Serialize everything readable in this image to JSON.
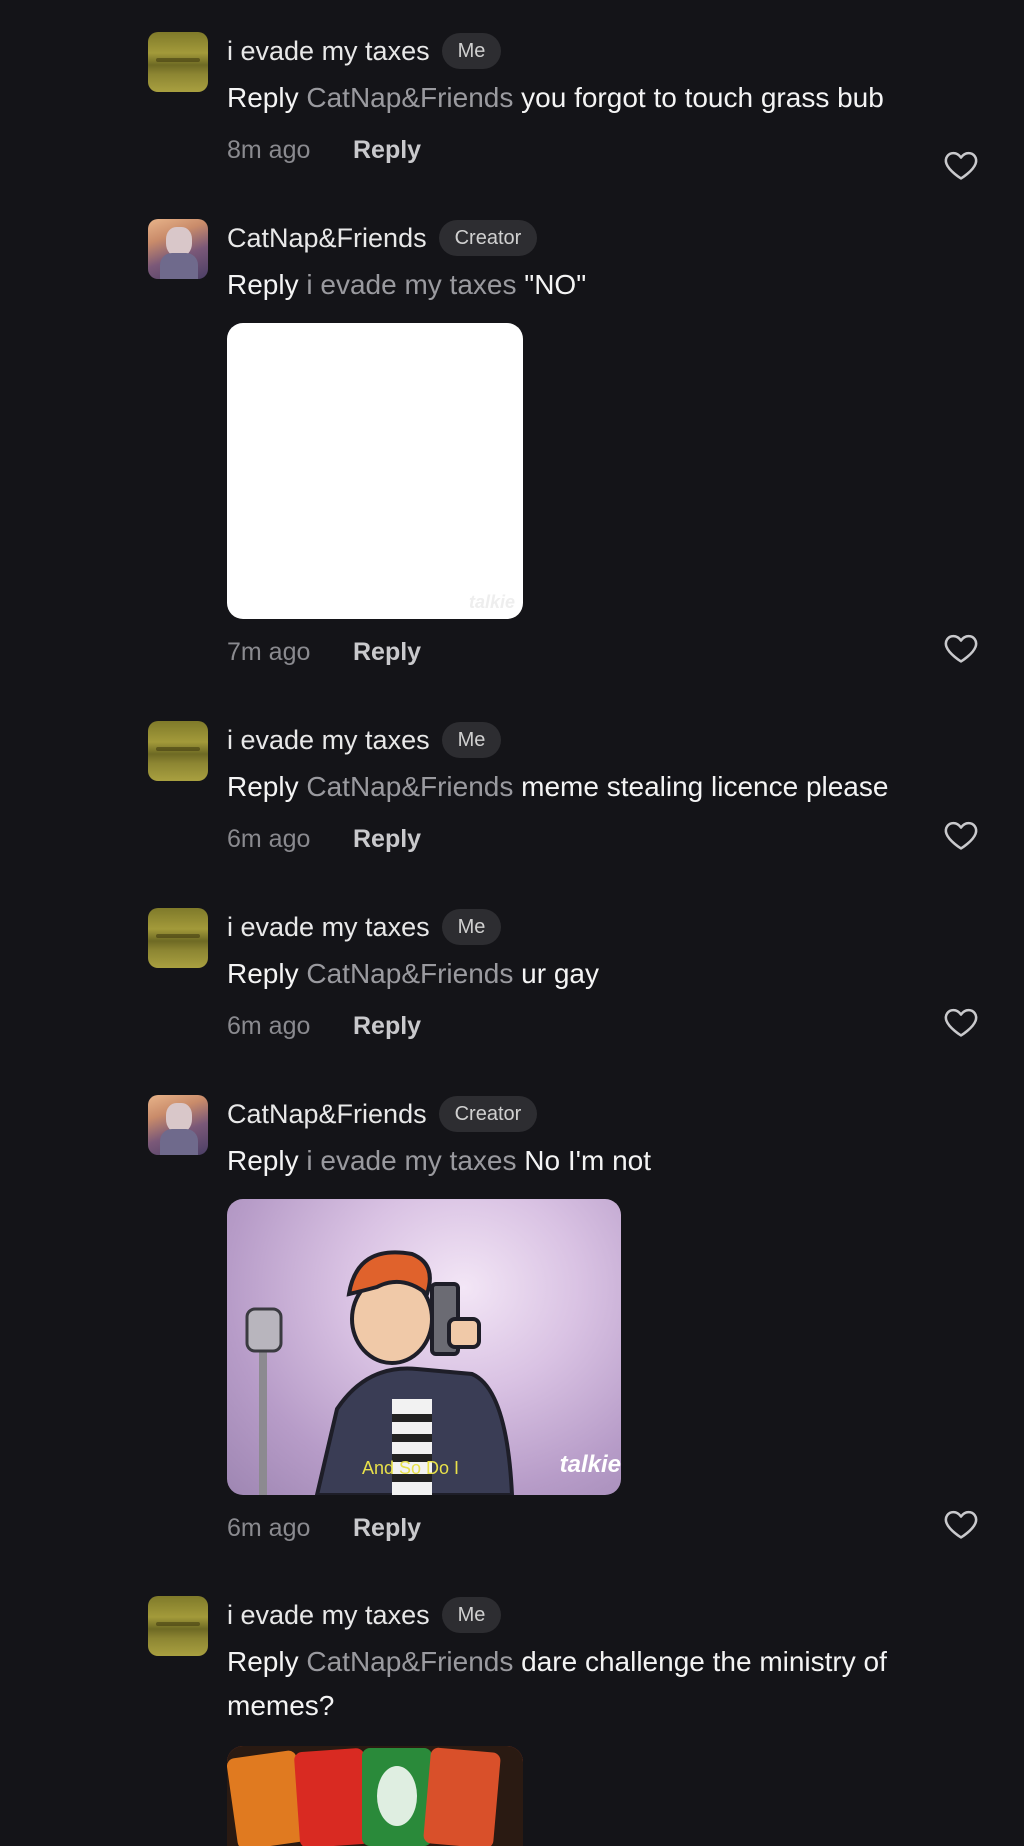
{
  "comments": [
    {
      "author": "i evade my taxes",
      "badge": "Me",
      "reply_word": "Reply",
      "mention": "CatNap&Friends",
      "text": "you forgot to touch grass bub",
      "time": "8m ago",
      "reply_label": "Reply"
    },
    {
      "author": "CatNap&Friends",
      "badge": "Creator",
      "reply_word": "Reply",
      "mention": "i evade my taxes",
      "text": "\"NO\"",
      "watermark": "talkie",
      "time": "7m ago",
      "reply_label": "Reply"
    },
    {
      "author": "i evade my taxes",
      "badge": "Me",
      "reply_word": "Reply",
      "mention": "CatNap&Friends",
      "text": "meme stealing licence please",
      "time": "6m ago",
      "reply_label": "Reply"
    },
    {
      "author": "i evade my taxes",
      "badge": "Me",
      "reply_word": "Reply",
      "mention": "CatNap&Friends",
      "text": "ur gay",
      "time": "6m ago",
      "reply_label": "Reply"
    },
    {
      "author": "CatNap&Friends",
      "badge": "Creator",
      "reply_word": "Reply",
      "mention": "i evade my taxes",
      "text": "No I'm not",
      "media_caption": "And So Do I",
      "watermark": "talkie",
      "time": "6m ago",
      "reply_label": "Reply"
    },
    {
      "author": "i evade my taxes",
      "badge": "Me",
      "reply_word": "Reply",
      "mention": "CatNap&Friends",
      "text": "dare challenge the ministry of memes?"
    }
  ]
}
